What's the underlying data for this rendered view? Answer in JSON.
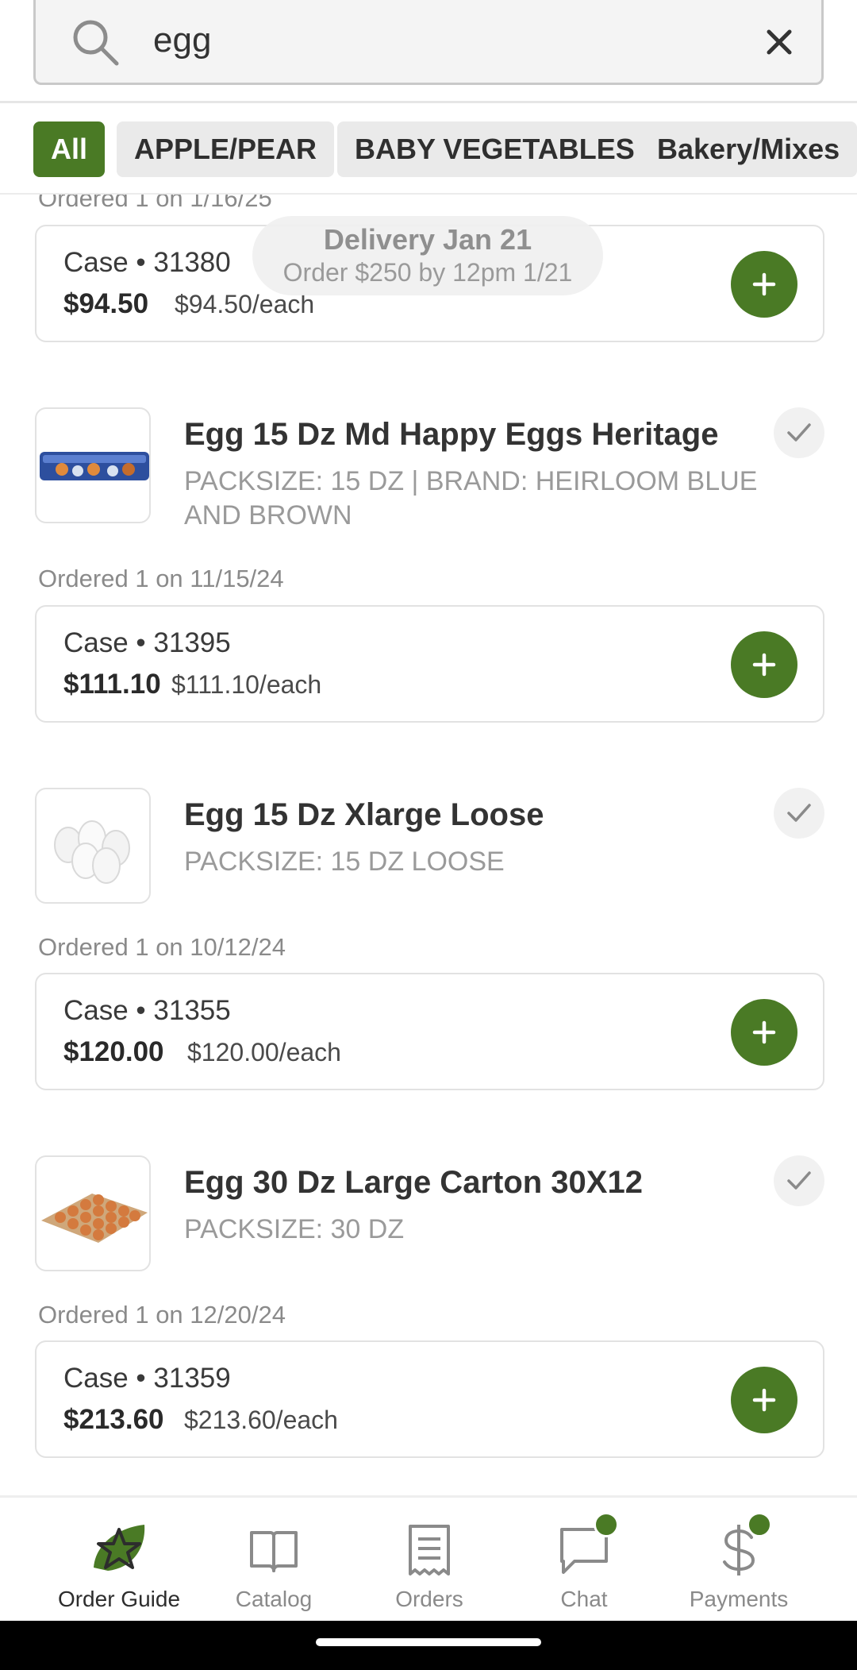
{
  "search": {
    "query": "egg",
    "clear_label": "×"
  },
  "filters": [
    "All",
    "APPLE/PEAR",
    "BABY VEGETABLES",
    "Bakery/Mixes"
  ],
  "delivery": {
    "title": "Delivery Jan 21",
    "subtitle": "Order $250 by 12pm 1/21"
  },
  "items": [
    {
      "ordered": "Ordered 1 on 1/16/25",
      "case": "Case • 31380",
      "price": "$94.50",
      "each": "$94.50/each"
    },
    {
      "name": "Egg 15 Dz Md Happy Eggs Heritage",
      "desc": "PACKSIZE: 15 DZ | BRAND: HEIRLOOM BLUE AND BROWN",
      "ordered": "Ordered 1 on 11/15/24",
      "case": "Case • 31395",
      "price": "$111.10",
      "each": "$111.10/each"
    },
    {
      "name": "Egg 15 Dz Xlarge Loose",
      "desc": "PACKSIZE: 15 DZ LOOSE",
      "ordered": "Ordered 1 on 10/12/24",
      "case": "Case • 31355",
      "price": "$120.00",
      "each": "$120.00/each"
    },
    {
      "name": "Egg 30 Dz Large Carton 30X12",
      "desc": "PACKSIZE: 30 DZ",
      "ordered": "Ordered 1 on 12/20/24",
      "case": "Case • 31359",
      "price": "$213.60",
      "each": "$213.60/each"
    }
  ],
  "nav": [
    {
      "label": "Order Guide",
      "icon": "star-icon",
      "active": true
    },
    {
      "label": "Catalog",
      "icon": "book-icon"
    },
    {
      "label": "Orders",
      "icon": "receipt-icon"
    },
    {
      "label": "Chat",
      "icon": "chat-icon",
      "badge": true
    },
    {
      "label": "Payments",
      "icon": "dollar-icon",
      "badge": true
    }
  ],
  "colors": {
    "accent": "#4a7a25",
    "chip_bg": "#eaeaea",
    "muted_text": "#8a8a8a"
  }
}
